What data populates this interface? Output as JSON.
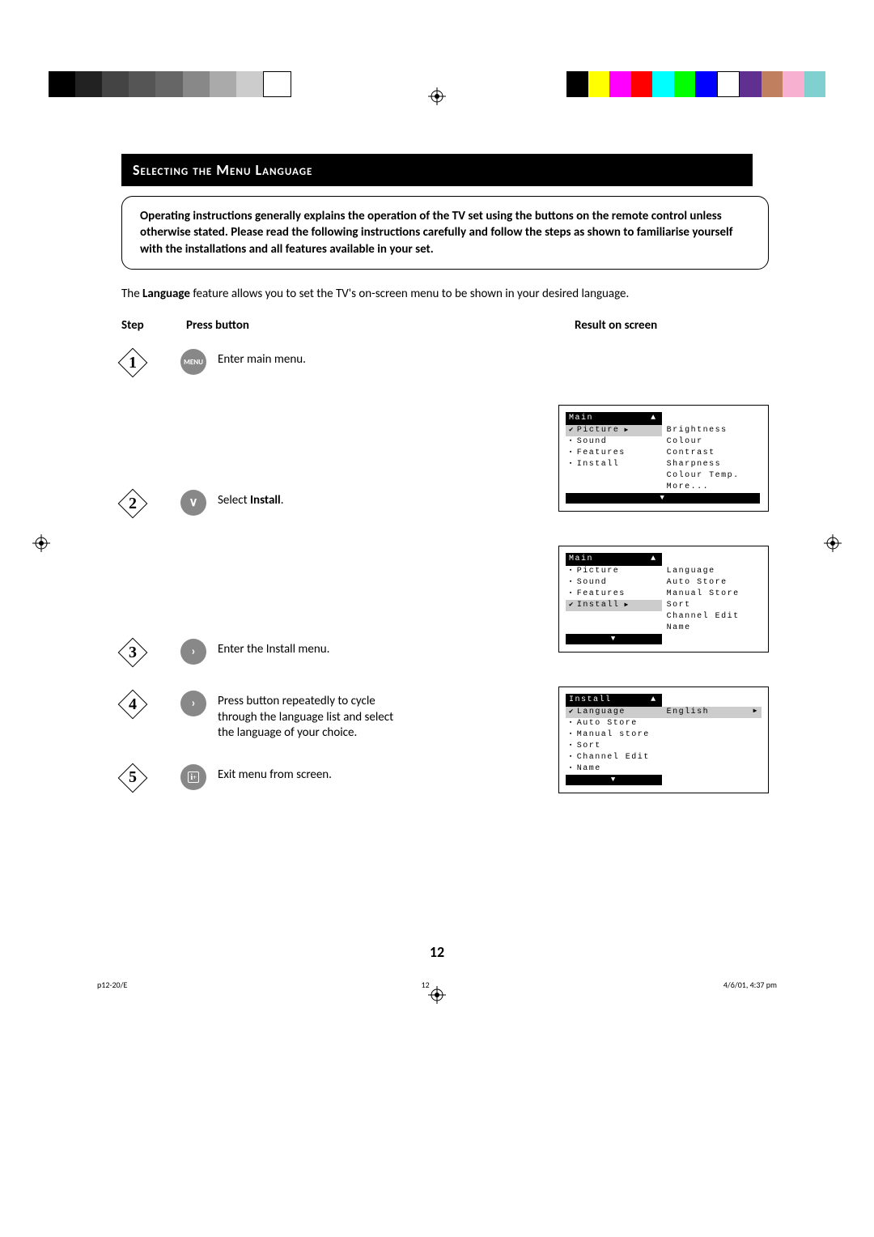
{
  "title": "Selecting the Menu Language",
  "intro": "Operating instructions generally explains the operation of the TV set using the buttons on the remote control unless otherwise stated. Please read the following instructions carefully and follow the steps as shown to familiarise yourself with the installations and all features available in your set.",
  "desc_prefix": "The ",
  "desc_bold": "Language",
  "desc_suffix": " feature allows you to set the TV's on-screen menu to be shown in your desired language.",
  "headers": {
    "step": "Step",
    "press": "Press button",
    "result": "Result on screen"
  },
  "steps": [
    {
      "num": "1",
      "button_type": "menu",
      "button_label": "MENU",
      "text": "Enter main menu."
    },
    {
      "num": "2",
      "button_type": "down",
      "button_label": "∨",
      "text_prefix": "Select ",
      "text_bold": "Install",
      "text_suffix": "."
    },
    {
      "num": "3",
      "button_type": "right",
      "button_label": "›",
      "text": "Enter the Install menu."
    },
    {
      "num": "4",
      "button_type": "right",
      "button_label": "›",
      "text": "Press button repeatedly to cycle through the language list and select the language of your choice."
    },
    {
      "num": "5",
      "button_type": "info",
      "button_label": "i+",
      "text": "Exit menu from screen."
    }
  ],
  "osd1": {
    "title": "Main",
    "left": [
      {
        "label": "Picture",
        "selected": true,
        "checked": true,
        "arrow": true
      },
      {
        "label": "Sound"
      },
      {
        "label": "Features"
      },
      {
        "label": "Install"
      }
    ],
    "right": [
      "Brightness",
      "Colour",
      "Contrast",
      "Sharpness",
      "Colour Temp.",
      "More..."
    ]
  },
  "osd2": {
    "title": "Main",
    "left": [
      {
        "label": "Picture"
      },
      {
        "label": "Sound"
      },
      {
        "label": "Features"
      },
      {
        "label": "Install",
        "selected": true,
        "checked": true,
        "arrow": true
      }
    ],
    "right": [
      "Language",
      "Auto Store",
      "Manual Store",
      "Sort",
      "Channel Edit",
      "Name"
    ]
  },
  "osd3": {
    "title": "Install",
    "items": [
      {
        "label": "Language",
        "value": "English",
        "selected": true,
        "checked": true,
        "arrow": true
      },
      {
        "label": "Auto Store"
      },
      {
        "label": "Manual store"
      },
      {
        "label": "Sort"
      },
      {
        "label": "Channel Edit"
      },
      {
        "label": "Name"
      }
    ]
  },
  "page_number": "12",
  "footer": {
    "left": "p12-20/E",
    "mid": "12",
    "right": "4/6/01, 4:37 pm"
  },
  "colors": {
    "bars_left": [
      "#000",
      "#222",
      "#444",
      "#555",
      "#666",
      "#888",
      "#aaa",
      "#ccc",
      "#fff"
    ],
    "bars_right": [
      "#000",
      "#ff0",
      "#f0f",
      "#f00",
      "#0ff",
      "#0f0",
      "#00f",
      "#fff",
      "#603090",
      "#c08060",
      "#f8b0d0",
      "#80d0d0"
    ]
  }
}
